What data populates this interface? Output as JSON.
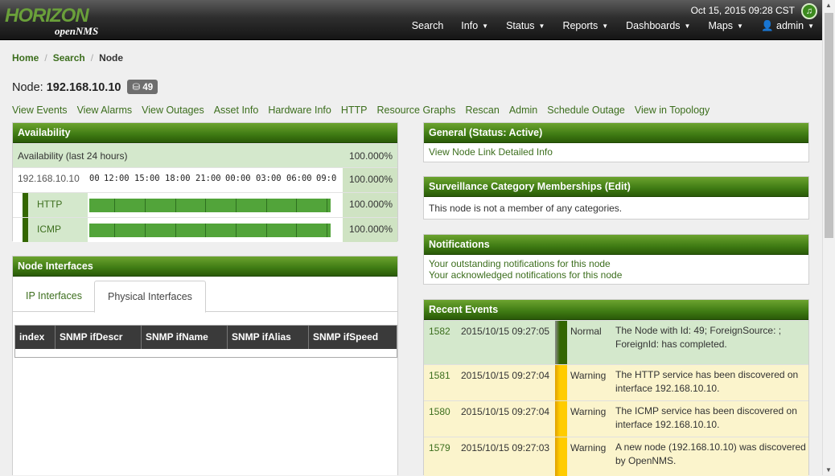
{
  "header": {
    "logo_main": "HORIZON",
    "logo_sub": "openNMS",
    "datetime": "Oct 15, 2015 09:28 CST",
    "nav": [
      {
        "label": "Search",
        "dropdown": false
      },
      {
        "label": "Info",
        "dropdown": true
      },
      {
        "label": "Status",
        "dropdown": true
      },
      {
        "label": "Reports",
        "dropdown": true
      },
      {
        "label": "Dashboards",
        "dropdown": true
      },
      {
        "label": "Maps",
        "dropdown": true
      },
      {
        "label": "admin",
        "dropdown": true
      }
    ]
  },
  "breadcrumb": {
    "home": "Home",
    "search": "Search",
    "current": "Node"
  },
  "node": {
    "title_prefix": "Node:",
    "ip": "192.168.10.10",
    "badge": "49"
  },
  "node_links": [
    "View Events",
    "View Alarms",
    "View Outages",
    "Asset Info",
    "Hardware Info",
    "HTTP",
    "Resource Graphs",
    "Rescan",
    "Admin",
    "Schedule Outage",
    "View in Topology"
  ],
  "availability": {
    "title": "Availability",
    "header_label": "Availability (last 24 hours)",
    "header_pct": "100.000%",
    "interface_label": "192.168.10.10",
    "interface_pct": "100.000%",
    "ticks": [
      "00",
      "12:00",
      "15:00",
      "18:00",
      "21:00",
      "00:00",
      "03:00",
      "06:00",
      "09:0"
    ],
    "services": [
      {
        "name": "HTTP",
        "pct": "100.000%",
        "availability": 1.0
      },
      {
        "name": "ICMP",
        "pct": "100.000%",
        "availability": 1.0
      }
    ]
  },
  "interfaces": {
    "title": "Node Interfaces",
    "tabs": [
      "IP Interfaces",
      "Physical Interfaces"
    ],
    "active_tab": "Physical Interfaces",
    "columns": [
      "index",
      "SNMP ifDescr",
      "SNMP ifName",
      "SNMP ifAlias",
      "SNMP ifSpeed"
    ]
  },
  "general": {
    "title": "General (Status: Active)",
    "link": "View Node Link Detailed Info"
  },
  "surveillance": {
    "title": "Surveillance Category Memberships (Edit)",
    "text": "This node is not a member of any categories."
  },
  "notifications": {
    "title": "Notifications",
    "outstanding": "Your outstanding notifications for this node",
    "acknowledged": "Your acknowledged notifications for this node"
  },
  "events": {
    "title": "Recent Events",
    "items": [
      {
        "id": "1582",
        "time": "2015/10/15 09:27:05",
        "severity": "Normal",
        "message": "The Node with Id: 49; ForeignSource: ; ForeignId: has completed."
      },
      {
        "id": "1581",
        "time": "2015/10/15 09:27:04",
        "severity": "Warning",
        "message": "The HTTP service has been discovered on interface 192.168.10.10."
      },
      {
        "id": "1580",
        "time": "2015/10/15 09:27:04",
        "severity": "Warning",
        "message": "The ICMP service has been discovered on interface 192.168.10.10."
      },
      {
        "id": "1579",
        "time": "2015/10/15 09:27:03",
        "severity": "Warning",
        "message": "A new node (192.168.10.10) was discovered by OpenNMS."
      }
    ]
  },
  "colors": {
    "accent": "#3c6e1d",
    "normal": "#336600",
    "warning": "#ffcc00"
  }
}
